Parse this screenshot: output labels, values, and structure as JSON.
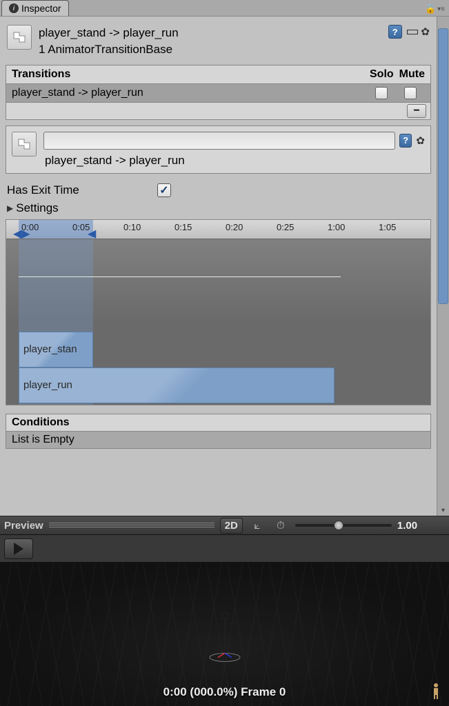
{
  "tab": {
    "title": "Inspector"
  },
  "header": {
    "title": "player_stand -> player_run",
    "subtitle": "1 AnimatorTransitionBase"
  },
  "transitions": {
    "header": "Transitions",
    "col_solo": "Solo",
    "col_mute": "Mute",
    "items": [
      {
        "label": "player_stand -> player_run"
      }
    ]
  },
  "selected": {
    "name_value": "",
    "label": "player_stand -> player_run"
  },
  "has_exit_time": {
    "label": "Has Exit Time",
    "checked": true
  },
  "settings_label": "Settings",
  "timeline": {
    "ticks": [
      "0:00",
      "0:05",
      "0:10",
      "0:15",
      "0:20",
      "0:25",
      "1:00",
      "1:05"
    ],
    "clip_a": "player_stan",
    "clip_b": "player_run"
  },
  "conditions": {
    "header": "Conditions",
    "empty": "List is Empty"
  },
  "preview": {
    "label": "Preview",
    "mode_2d": "2D",
    "speed_value": "1.00",
    "status": "0:00 (000.0%) Frame 0"
  }
}
